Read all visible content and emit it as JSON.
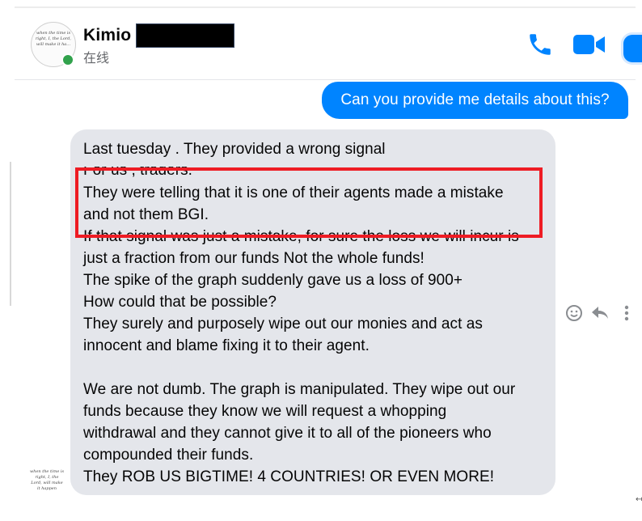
{
  "header": {
    "contact_name": "Kimio",
    "status": "在线",
    "avatar_text": "when the time is right, I, the Lord, will make it ha...",
    "call_icon": "phone-icon",
    "video_icon": "video-camera-icon",
    "accent_color": "#0084ff"
  },
  "conversation": {
    "outgoing_message": "Can you provide me details about this?",
    "incoming_lines": [
      "Last tuesday . They provided a wrong signal",
      " For us , traders.",
      "They were telling that it is one of their agents made a mistake",
      "and not them BGI.",
      "If that signal was just a mistake, for sure the loss we will incur is",
      "just a fraction from our funds Not the  whole funds!",
      "The spike of the graph suddenly gave us a loss of 900+",
      "How could that be possible?",
      "They surely and purposely wipe out our monies and act as",
      "innocent and blame fixing it to their agent.",
      "We are not dumb. The graph is manipulated. They wipe out our",
      "funds because they know we will request a whopping",
      "withdrawal and they cannot give it to all of the pioneers who",
      "compounded their funds.",
      "They ROB US BIGTIME! 4 COUNTRIES! OR EVEN MORE!"
    ],
    "message_actions": [
      "smiley-icon",
      "reply-icon",
      "more-options-icon"
    ],
    "highlight_color": "#ee1c24"
  },
  "footer": {
    "small_avatar_text": "when the time is right, I, the Lord, will make it happen"
  }
}
